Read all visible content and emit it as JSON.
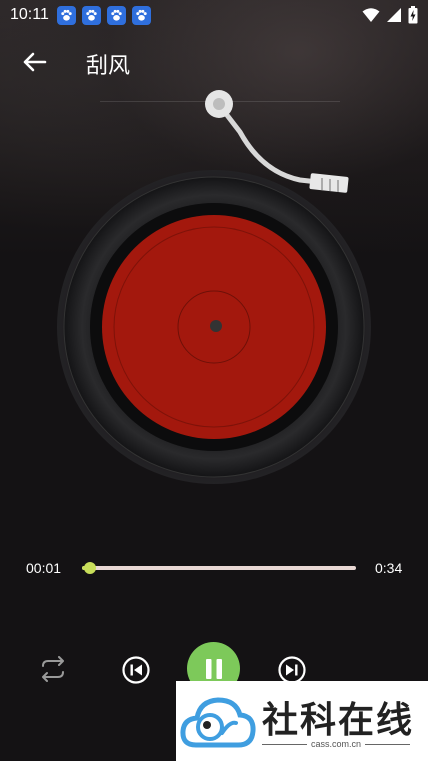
{
  "status_bar": {
    "time": "10:11",
    "notification_icons": [
      "baidu-paw-icon",
      "baidu-paw-icon",
      "baidu-paw-icon",
      "baidu-paw-icon"
    ],
    "system_icons": [
      "wifi-icon",
      "cell-signal-icon",
      "battery-charging-icon"
    ]
  },
  "header": {
    "back_icon": "back-arrow-icon",
    "title": "刮风"
  },
  "player": {
    "disc_label_color": "#a3180d",
    "tonearm": "tonearm"
  },
  "progress": {
    "current": "00:01",
    "total": "0:34",
    "fraction": 0.03,
    "accent": "#c8de5a",
    "track_color": "#e9d8d4"
  },
  "controls": {
    "repeat_icon": "repeat-icon",
    "prev_icon": "skip-previous-icon",
    "play_pause_icon": "pause-icon",
    "next_icon": "skip-next-icon",
    "play_color": "#7dc95a"
  },
  "watermark": {
    "text": "社科在线",
    "subtext": "cass.com.cn"
  }
}
